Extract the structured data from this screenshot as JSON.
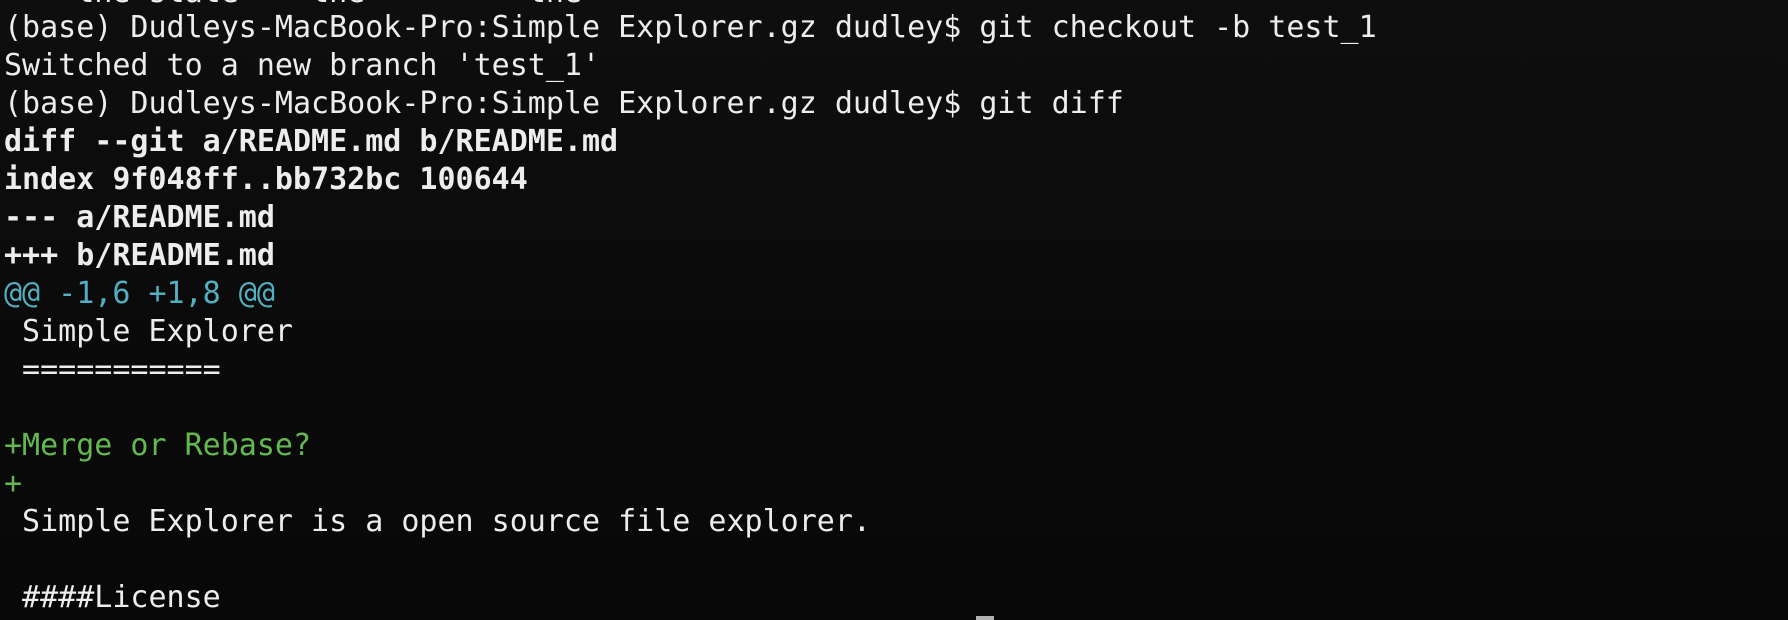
{
  "terminal": {
    "clipped_top_line": "    the state    the         the",
    "lines": [
      {
        "text": "(base) Dudleys-MacBook-Pro:Simple Explorer.gz dudley$ git checkout -b test_1",
        "kind": "prompt"
      },
      {
        "text": "Switched to a new branch 'test_1'",
        "kind": "output"
      },
      {
        "text": "(base) Dudleys-MacBook-Pro:Simple Explorer.gz dudley$ git diff",
        "kind": "prompt"
      },
      {
        "text": "diff --git a/README.md b/README.md",
        "kind": "meta"
      },
      {
        "text": "index 9f048ff..bb732bc 100644",
        "kind": "meta"
      },
      {
        "text": "--- a/README.md",
        "kind": "meta"
      },
      {
        "text": "+++ b/README.md",
        "kind": "meta"
      },
      {
        "text": "@@ -1,6 +1,8 @@",
        "kind": "hunk"
      },
      {
        "text": " Simple Explorer",
        "kind": "context"
      },
      {
        "text": " ===========",
        "kind": "context"
      },
      {
        "text": "",
        "kind": "context"
      },
      {
        "text": "+Merge or Rebase?",
        "kind": "added"
      },
      {
        "text": "+",
        "kind": "added"
      },
      {
        "text": " Simple Explorer is a open source file explorer.",
        "kind": "context"
      },
      {
        "text": "",
        "kind": "context"
      },
      {
        "text": " ####License",
        "kind": "context"
      }
    ],
    "colors": {
      "background": "#0c0c0c",
      "foreground": "#ededed",
      "hunk_header": "#53aec0",
      "added_line": "#63b851"
    }
  }
}
